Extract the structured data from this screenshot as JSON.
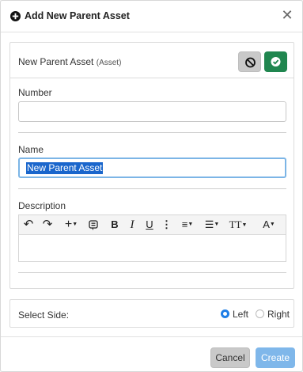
{
  "dialog": {
    "title": "Add New Parent Asset",
    "close_glyph": "✕"
  },
  "asset_card": {
    "title": "New Parent Asset",
    "subtitle": "(Asset)",
    "cancel_icon": "ban-icon",
    "confirm_icon": "check-circle-icon"
  },
  "form": {
    "number_label": "Number",
    "number_value": "",
    "name_label": "Name",
    "name_value": "New Parent Asset",
    "description_label": "Description",
    "description_value": ""
  },
  "toolbar": {
    "undo": "↶",
    "redo": "↷",
    "insert": "+",
    "bold": "B",
    "italic": "I",
    "underline": "U",
    "more": "⋮",
    "align": "≡",
    "list": "☰",
    "text_size": "TT",
    "text_color": "A"
  },
  "side": {
    "label": "Select Side:",
    "options": [
      "Left",
      "Right"
    ],
    "selected": "Left"
  },
  "footer": {
    "cancel_label": "Cancel",
    "create_label": "Create"
  },
  "colors": {
    "accent": "#1f7ee6",
    "confirm_green": "#20864f",
    "create_disabled": "#7fb7ea"
  }
}
